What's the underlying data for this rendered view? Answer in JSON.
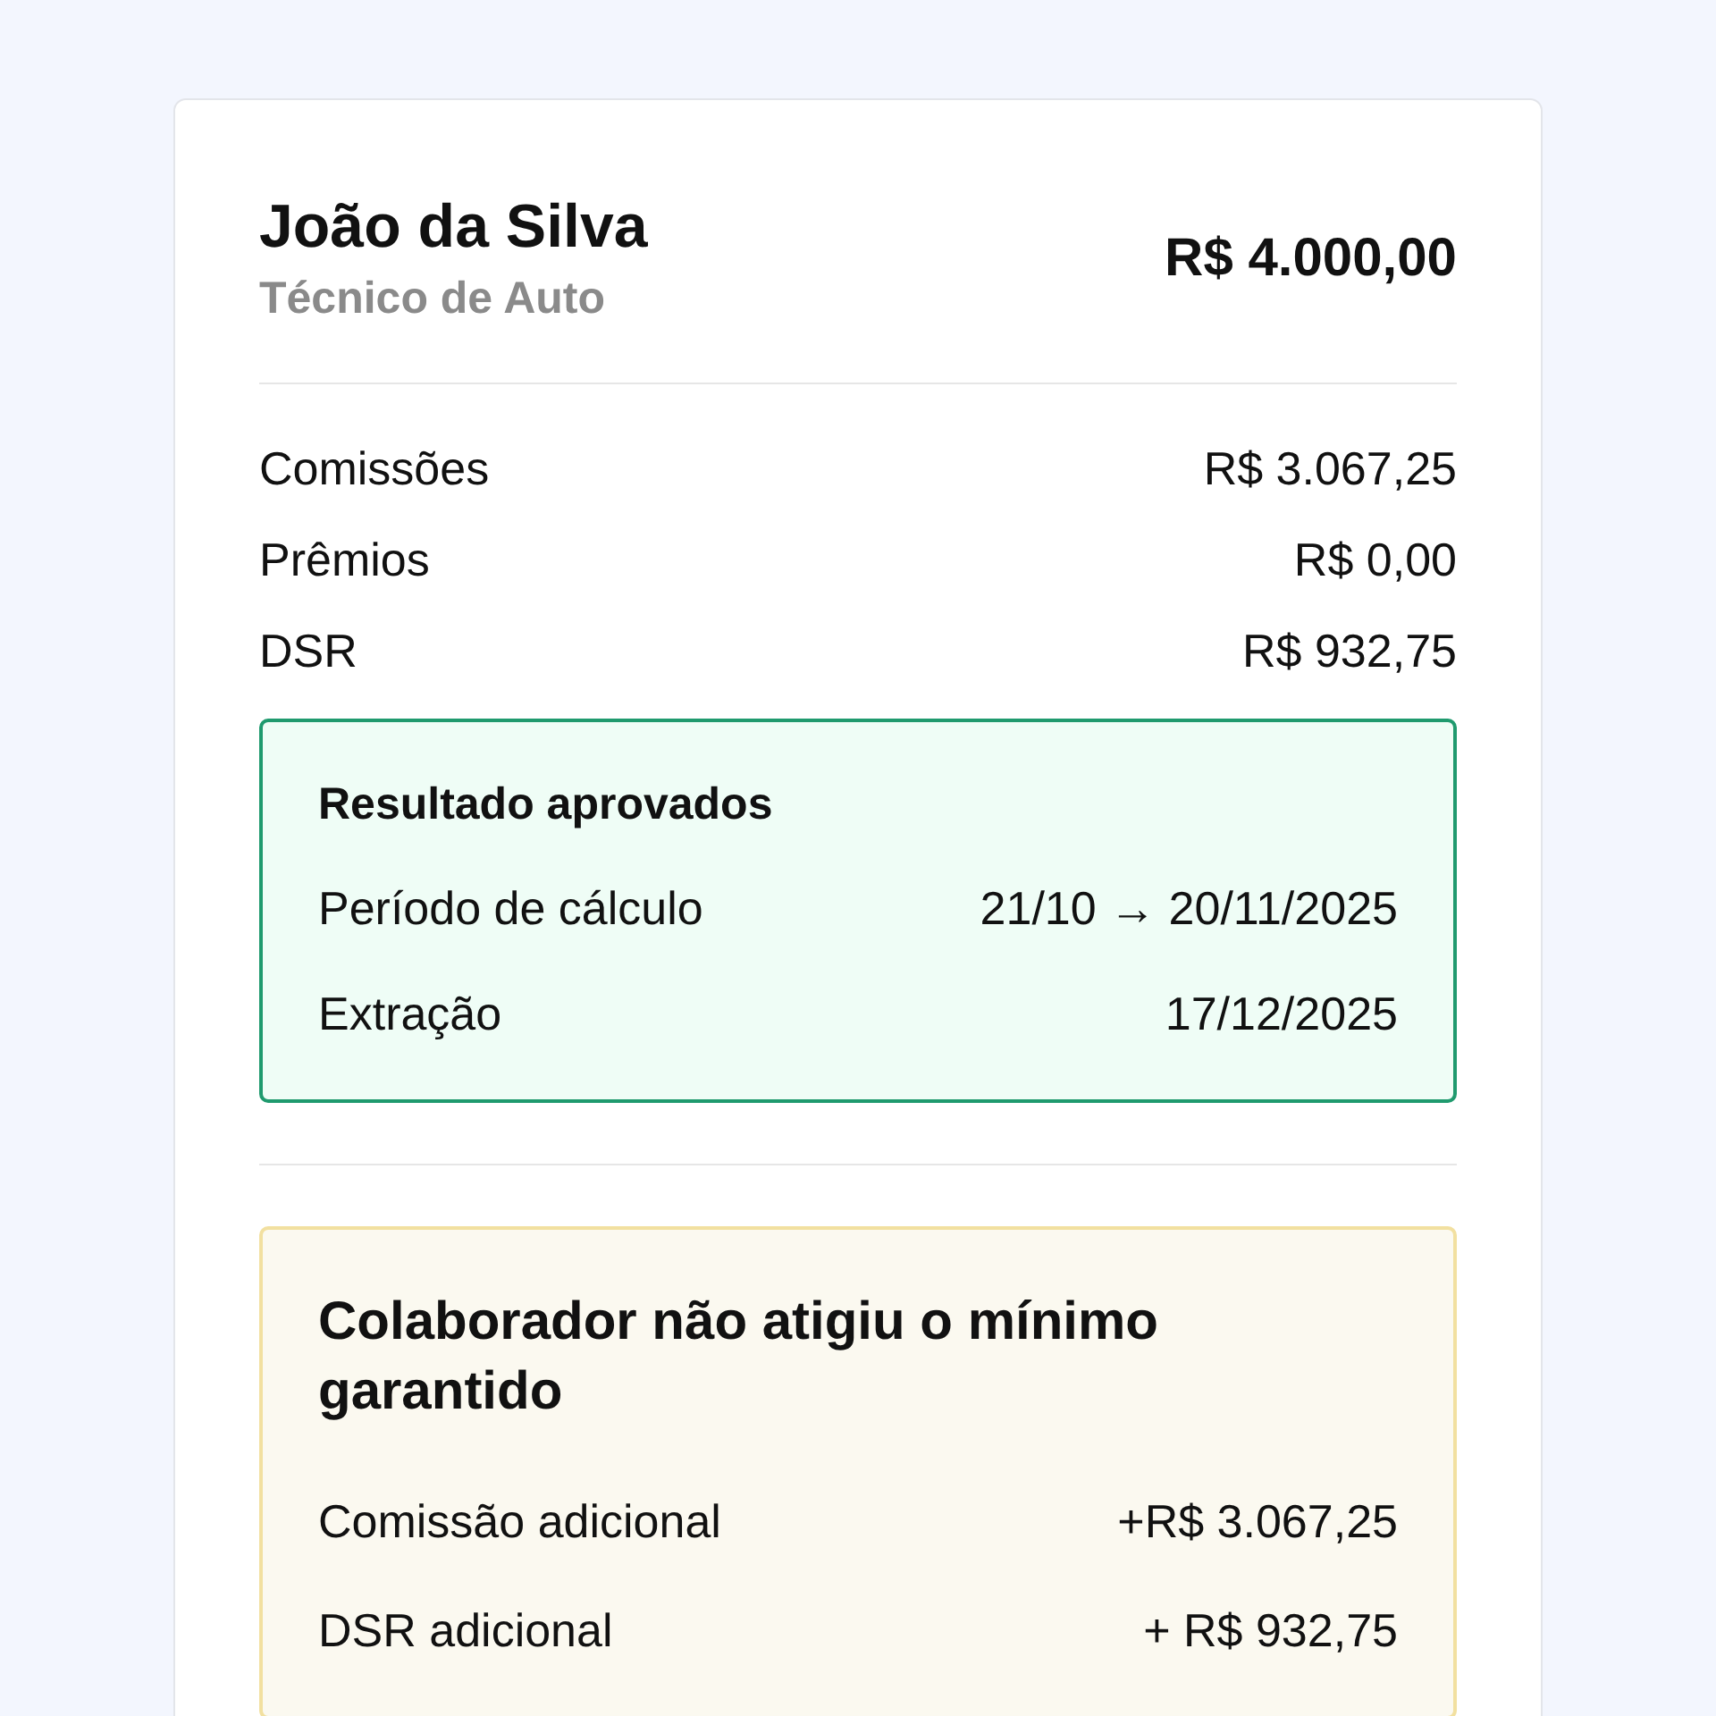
{
  "employee": {
    "name": "João da Silva",
    "role": "Técnico de Auto",
    "total": "R$ 4.000,00"
  },
  "breakdown": [
    {
      "label": "Comissões",
      "value": "R$ 3.067,25"
    },
    {
      "label": "Prêmios",
      "value": "R$ 0,00"
    },
    {
      "label": "DSR",
      "value": "R$ 932,75"
    }
  ],
  "result_box": {
    "title": "Resultado aprovados",
    "rows": [
      {
        "label": "Período de cálculo",
        "value": "21/10 → 20/11/2025"
      },
      {
        "label": "Extração",
        "value": "17/12/2025"
      }
    ]
  },
  "minimum_box": {
    "title": "Colaborador não atigiu o mínimo garantido",
    "rows": [
      {
        "label": "Comissão adicional",
        "value": "+R$ 3.067,25"
      },
      {
        "label": "DSR adicional",
        "value": "+ R$ 932,75"
      }
    ]
  }
}
